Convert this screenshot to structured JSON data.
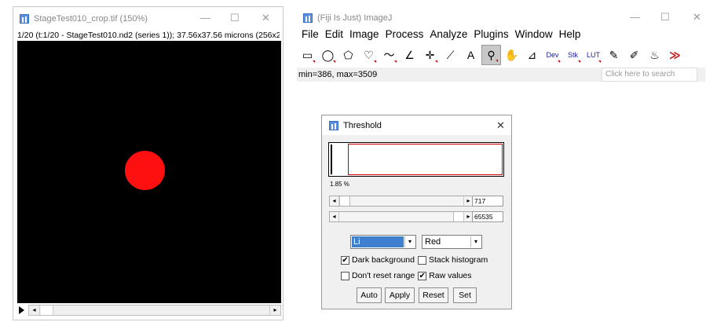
{
  "image_window": {
    "title": "StageTest010_crop.tif (150%)",
    "subtitle": "1/20 (t:1/20 - StageTest010.nd2 (series 1)); 37.56x37.56 microns (256x2",
    "controls": {
      "minimize": "—",
      "maximize": "☐",
      "close": "✕"
    },
    "scroll_left": "◂",
    "scroll_right": "▸"
  },
  "main_window": {
    "title": "(Fiji Is Just) ImageJ",
    "controls": {
      "minimize": "—",
      "maximize": "☐",
      "close": "✕"
    },
    "menu": [
      "File",
      "Edit",
      "Image",
      "Process",
      "Analyze",
      "Plugins",
      "Window",
      "Help"
    ],
    "tools": [
      {
        "icon": "rectangle-icon",
        "glyph": "▭",
        "dropdown": true
      },
      {
        "icon": "oval-icon",
        "glyph": "◯",
        "dropdown": true
      },
      {
        "icon": "polygon-icon",
        "glyph": "⬠",
        "dropdown": false
      },
      {
        "icon": "freehand-icon",
        "glyph": "♡",
        "dropdown": true
      },
      {
        "icon": "line-icon",
        "glyph": "〜",
        "dropdown": true
      },
      {
        "icon": "angle-icon",
        "glyph": "∠",
        "dropdown": false
      },
      {
        "icon": "point-icon",
        "glyph": "✛",
        "dropdown": true
      },
      {
        "icon": "wand-icon",
        "glyph": "⟋",
        "dropdown": false
      },
      {
        "icon": "text-icon",
        "glyph": "A",
        "dropdown": false
      },
      {
        "icon": "magnifier-icon",
        "glyph": "⚲",
        "dropdown": true,
        "selected": true
      },
      {
        "icon": "hand-icon",
        "glyph": "✋",
        "dropdown": false
      },
      {
        "icon": "dropper-icon",
        "glyph": "⊿",
        "dropdown": false
      },
      {
        "icon": "dev-icon",
        "label": "Dev",
        "dropdown": true
      },
      {
        "icon": "stk-icon",
        "label": "Stk",
        "dropdown": true
      },
      {
        "icon": "lut-icon",
        "label": "LUT",
        "dropdown": true
      },
      {
        "icon": "pencil-icon",
        "glyph": "✎",
        "dropdown": false
      },
      {
        "icon": "brush-icon",
        "glyph": "✐",
        "dropdown": false
      },
      {
        "icon": "flood-fill-icon",
        "glyph": "♨",
        "dropdown": false
      },
      {
        "icon": "more-tools-icon",
        "glyph": "≫",
        "dropdown": false
      }
    ],
    "status": "min=386, max=3509",
    "search_placeholder": "Click here to search"
  },
  "threshold": {
    "title": "Threshold",
    "close": "✕",
    "percent": "1.85 %",
    "min_value": "717",
    "max_value": "65535",
    "method": "Li",
    "display": "Red",
    "dark_background": {
      "label": "Dark background",
      "checked": true
    },
    "stack_histogram": {
      "label": "Stack histogram",
      "checked": false
    },
    "dont_reset_range": {
      "label": "Don't reset range",
      "checked": false
    },
    "raw_values": {
      "label": "Raw values",
      "checked": true
    },
    "buttons": [
      "Auto",
      "Apply",
      "Reset",
      "Set"
    ],
    "check_mark": "✔",
    "arrow_left": "◂",
    "arrow_right": "▸",
    "dropdown_arrow": "▾"
  }
}
